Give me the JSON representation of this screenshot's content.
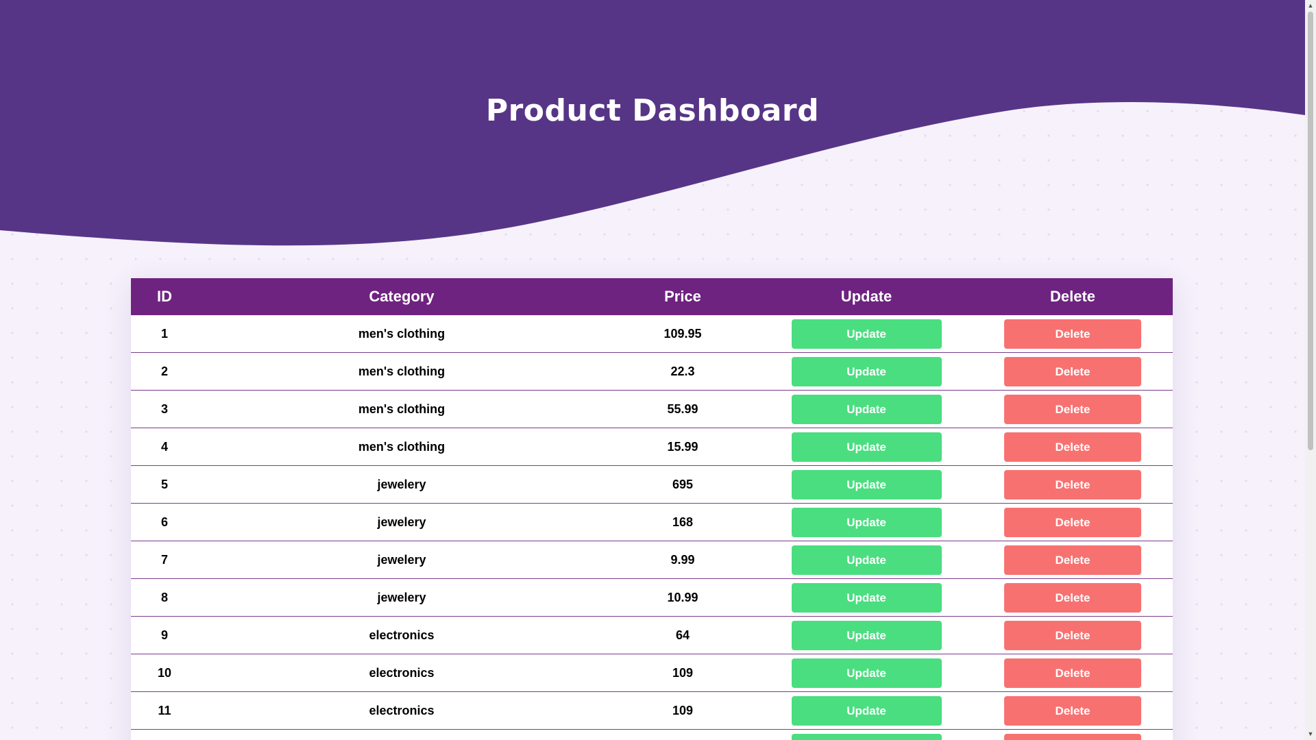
{
  "header": {
    "title": "Product Dashboard"
  },
  "table": {
    "columns": [
      "ID",
      "Category",
      "Price",
      "Update",
      "Delete"
    ],
    "update_label": "Update",
    "delete_label": "Delete",
    "rows": [
      {
        "id": "1",
        "category": "men's clothing",
        "price": "109.95"
      },
      {
        "id": "2",
        "category": "men's clothing",
        "price": "22.3"
      },
      {
        "id": "3",
        "category": "men's clothing",
        "price": "55.99"
      },
      {
        "id": "4",
        "category": "men's clothing",
        "price": "15.99"
      },
      {
        "id": "5",
        "category": "jewelery",
        "price": "695"
      },
      {
        "id": "6",
        "category": "jewelery",
        "price": "168"
      },
      {
        "id": "7",
        "category": "jewelery",
        "price": "9.99"
      },
      {
        "id": "8",
        "category": "jewelery",
        "price": "10.99"
      },
      {
        "id": "9",
        "category": "electronics",
        "price": "64"
      },
      {
        "id": "10",
        "category": "electronics",
        "price": "109"
      },
      {
        "id": "11",
        "category": "electronics",
        "price": "109"
      },
      {
        "id": "",
        "category": "",
        "price": ""
      }
    ]
  },
  "colors": {
    "header_wave": "#573586",
    "table_header": "#6e2380",
    "update_button": "#4ade80",
    "delete_button": "#f87171",
    "background": "#f6f1fb"
  },
  "icons": {
    "scroll_up": "chevron-up-icon",
    "scroll_down": "chevron-down-icon"
  }
}
